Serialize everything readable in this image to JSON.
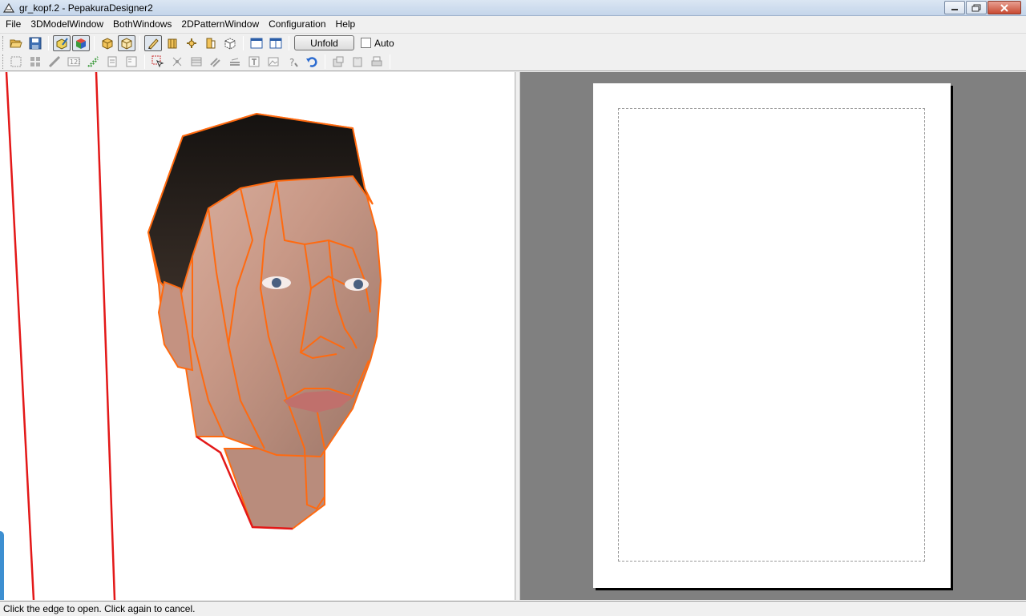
{
  "window": {
    "title": "gr_kopf.2 - PepakuraDesigner2"
  },
  "menu": [
    "File",
    "3DModelWindow",
    "BothWindows",
    "2DPatternWindow",
    "Configuration",
    "Help"
  ],
  "toolbar": {
    "unfold_label": "Unfold",
    "auto_label": "Auto",
    "auto_checked": false
  },
  "status": {
    "text": "Click the edge to open. Click again to cancel."
  }
}
